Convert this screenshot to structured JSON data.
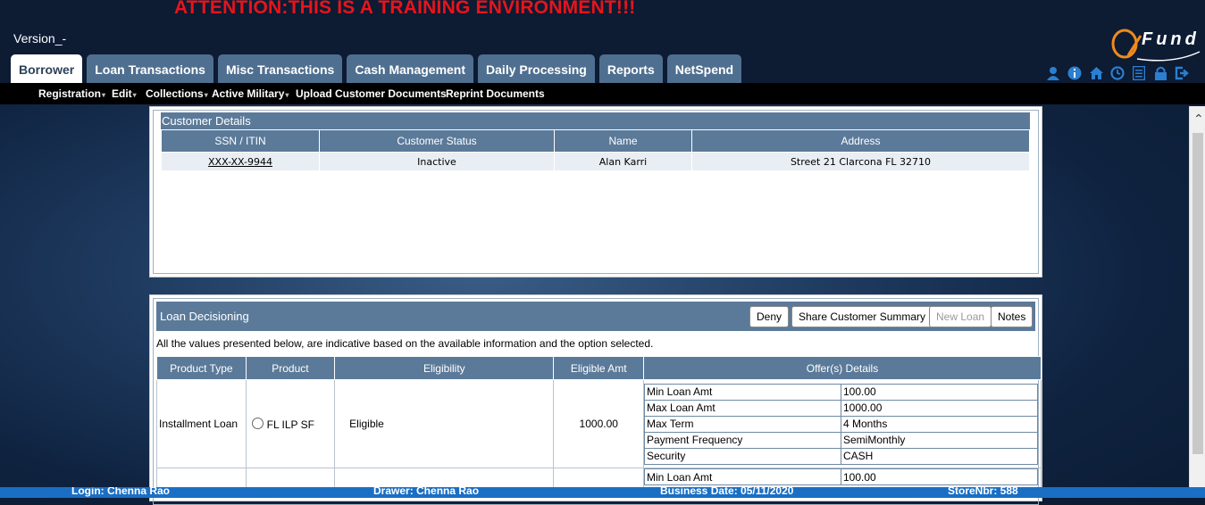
{
  "banner": {
    "attention": "ATTENTION:THIS IS A TRAINING ENVIRONMENT!!!",
    "version": "Version_-"
  },
  "logo": {
    "text": "Fund"
  },
  "tabs": [
    "Borrower",
    "Loan Transactions",
    "Misc Transactions",
    "Cash Management",
    "Daily Processing",
    "Reports",
    "NetSpend"
  ],
  "active_tab": "Borrower",
  "header_icons": [
    "user-icon",
    "info-icon",
    "home-icon",
    "clock-icon",
    "list-icon",
    "lock-icon",
    "logout-icon"
  ],
  "submenu": [
    "Registration",
    "Edit",
    "Collections",
    "Active Military",
    "Upload Customer Documents",
    "Reprint Documents"
  ],
  "customer": {
    "title": "Customer Details",
    "headers": [
      "SSN / ITIN",
      "Customer Status",
      "Name",
      "Address"
    ],
    "row": {
      "ssn": "XXX-XX-9944",
      "status": "Inactive",
      "name": "Alan  Karri",
      "address": "Street 21 Clarcona FL 32710"
    }
  },
  "loan": {
    "title": "Loan Decisioning",
    "buttons": {
      "deny": "Deny",
      "share": "Share Customer Summary",
      "new_loan": "New Loan",
      "notes": "Notes"
    },
    "note": "All the values presented below, are indicative based on the available information and the option selected.",
    "headers": [
      "Product Type",
      "Product",
      "Eligibility",
      "Eligible Amt",
      "Offer(s) Details"
    ],
    "row1": {
      "product_type": "Installment Loan",
      "product": "FL ILP SF",
      "eligibility": "Eligible",
      "eligible_amt": "1000.00",
      "offers": [
        {
          "label": "Min Loan Amt",
          "value": "100.00"
        },
        {
          "label": "Max Loan Amt",
          "value": "1000.00"
        },
        {
          "label": "Max Term",
          "value": "4 Months"
        },
        {
          "label": "Payment Frequency",
          "value": "SemiMonthly"
        },
        {
          "label": "Security",
          "value": "CASH"
        }
      ]
    },
    "row2": {
      "offers": [
        {
          "label": "Min Loan Amt",
          "value": "100.00"
        }
      ]
    }
  },
  "footer": {
    "login": "Login: Chenna Rao",
    "drawer": "Drawer: Chenna Rao",
    "business_date": "Business Date: 05/11/2020",
    "store": "StoreNbr: 588"
  },
  "colors": {
    "attention": "#e8141b",
    "tab_bg": "#4f6f90",
    "header_bg": "#5b7a99",
    "footer_bg": "#1a6fc4"
  }
}
